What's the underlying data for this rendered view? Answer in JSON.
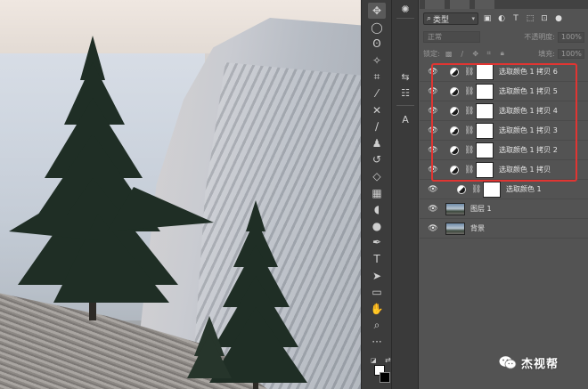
{
  "toolbar": {
    "tools": [
      {
        "name": "move-tool",
        "glyph": "✥",
        "active": true
      },
      {
        "name": "marquee-tool",
        "glyph": "◯"
      },
      {
        "name": "lasso-tool",
        "glyph": "ʘ"
      },
      {
        "name": "magic-wand-tool",
        "glyph": "✧"
      },
      {
        "name": "crop-tool",
        "glyph": "⌗"
      },
      {
        "name": "eyedropper-tool",
        "glyph": "⁄"
      },
      {
        "name": "healing-brush-tool",
        "glyph": "✕"
      },
      {
        "name": "brush-tool",
        "glyph": "∕"
      },
      {
        "name": "clone-stamp-tool",
        "glyph": "♟"
      },
      {
        "name": "history-brush-tool",
        "glyph": "↺"
      },
      {
        "name": "eraser-tool",
        "glyph": "◇"
      },
      {
        "name": "gradient-tool",
        "glyph": "▦"
      },
      {
        "name": "blur-tool",
        "glyph": "◖"
      },
      {
        "name": "dodge-tool",
        "glyph": "●"
      },
      {
        "name": "pen-tool",
        "glyph": "✒"
      },
      {
        "name": "type-tool",
        "glyph": "T"
      },
      {
        "name": "path-selection-tool",
        "glyph": "➤"
      },
      {
        "name": "rectangle-tool",
        "glyph": "▭"
      },
      {
        "name": "hand-tool",
        "glyph": "✋"
      },
      {
        "name": "zoom-tool",
        "glyph": "⌕"
      },
      {
        "name": "more-tools",
        "glyph": "···"
      }
    ]
  },
  "strip": {
    "buttons": [
      {
        "name": "history-panel-icon",
        "glyph": "✺"
      },
      {
        "name": "adjustments-panel-icon",
        "glyph": "⇆"
      },
      {
        "name": "properties-panel-icon",
        "glyph": "☷"
      },
      {
        "name": "character-panel-icon",
        "glyph": "A"
      }
    ]
  },
  "layers_panel": {
    "filter_type": "类型",
    "filter_icons": [
      {
        "name": "pixel-filter-icon",
        "glyph": "▣"
      },
      {
        "name": "adjustment-filter-icon",
        "glyph": "◐"
      },
      {
        "name": "type-filter-icon",
        "glyph": "T"
      },
      {
        "name": "shape-filter-icon",
        "glyph": "⬚"
      },
      {
        "name": "smart-object-filter-icon",
        "glyph": "⊡"
      },
      {
        "name": "filter-toggle-icon",
        "glyph": "●"
      }
    ],
    "blend_mode": "正常",
    "opacity_label": "不透明度:",
    "opacity_value": "100%",
    "lock_label": "锁定:",
    "fill_label": "填充:",
    "fill_value": "100%",
    "layers": [
      {
        "name": "选取颜色 1 拷贝 6",
        "kind": "adjustment"
      },
      {
        "name": "选取颜色 1 拷贝 5",
        "kind": "adjustment"
      },
      {
        "name": "选取颜色 1 拷贝 4",
        "kind": "adjustment"
      },
      {
        "name": "选取颜色 1 拷贝 3",
        "kind": "adjustment"
      },
      {
        "name": "选取颜色 1 拷贝 2",
        "kind": "adjustment"
      },
      {
        "name": "选取颜色 1 拷贝",
        "kind": "adjustment"
      },
      {
        "name": "选取颜色 1",
        "kind": "adjustment-sub"
      },
      {
        "name": "图层 1",
        "kind": "image"
      },
      {
        "name": "背景",
        "kind": "image"
      }
    ]
  },
  "watermark": {
    "text": "杰视帮"
  },
  "colors": {
    "highlight": "#e13532",
    "panel_bg": "#535353",
    "toolbar_bg": "#3c3c3c",
    "foreground": "#ffffff",
    "background": "#000000"
  }
}
